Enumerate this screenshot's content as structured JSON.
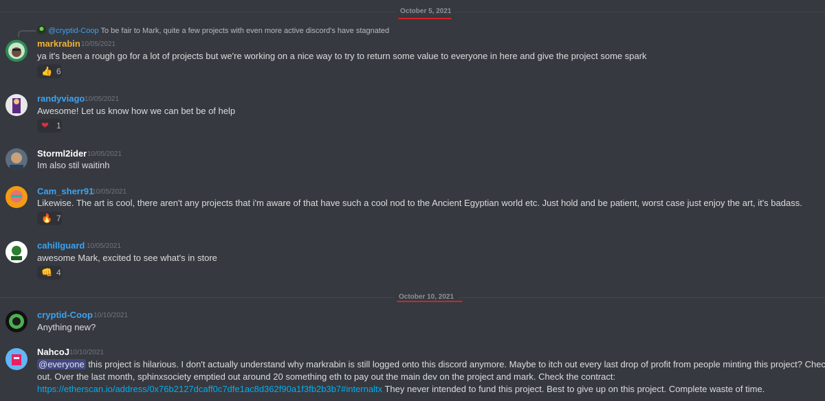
{
  "dividers": [
    {
      "label": "October 5, 2021"
    },
    {
      "label": "October 10, 2021"
    }
  ],
  "reply": {
    "author": "@cryptid-Coop",
    "text": "To be fair to Mark, quite a few projects with even more active discord's have stagnated"
  },
  "messages": [
    {
      "author": "markrabin",
      "author_color": "#f0b232",
      "timestamp": "10/05/2021",
      "text": "ya it's been a rough go for a lot of projects but we're working on a nice way to try to return some value to everyone in here and give the project some spark",
      "reaction": {
        "emoji_name": "thumbs-up-icon",
        "emoji": "👍",
        "count": "6"
      }
    },
    {
      "author": "randyviago",
      "author_color": "#3ba3f3",
      "timestamp": "10/05/2021",
      "text": "Awesome! Let us know how we can bet be of help",
      "reaction": {
        "emoji_name": "heart-icon",
        "emoji": "❤",
        "count": "1"
      }
    },
    {
      "author": "Storml2ider",
      "author_color": "#ffffff",
      "timestamp": "10/05/2021",
      "text": "Im also stil waitinh"
    },
    {
      "author": "Cam_sherr91",
      "author_color": "#3ba3f3",
      "timestamp": "10/05/2021",
      "text": "Likewise. The art is cool, there aren't any projects that i'm aware of that have such a cool nod to the Ancient Egyptian world etc. Just hold and be patient, worst case just enjoy the art, it's badass.",
      "reaction": {
        "emoji_name": "fire-icon",
        "emoji": "🔥",
        "count": "7"
      }
    },
    {
      "author": "cahillguard",
      "author_color": "#3ba3f3",
      "timestamp": "10/05/2021",
      "text": "awesome Mark, excited to see what's in store",
      "reaction": {
        "emoji_name": "punch-icon",
        "emoji": "👊",
        "count": "4"
      }
    },
    {
      "author": "cryptid-Coop",
      "author_color": "#3ba3f3",
      "timestamp": "10/10/2021",
      "text": "Anything new?"
    },
    {
      "author": "NahcoJ",
      "author_color": "#ffffff",
      "timestamp": "10/10/2021",
      "mention": "@everyone",
      "text_line1": "this project is hilarious. I don't actually understand why markrabin is still logged onto this discord anymore. Maybe to itch out every last drop of profit from people minting this project? Check it",
      "text_line2": "out. Over the last month, sphinxsociety emptied out around 20 something eth to pay out the main dev on the project and mark. Check the contract:",
      "link": "https://etherscan.io/address/0x76b2127dcaff0c7dfe1ac8d362f90a1f3fb2b3b7#internaltx",
      "text_line3": "They never intended to fund this project. Best to give up on this project. Complete waste of time."
    }
  ]
}
